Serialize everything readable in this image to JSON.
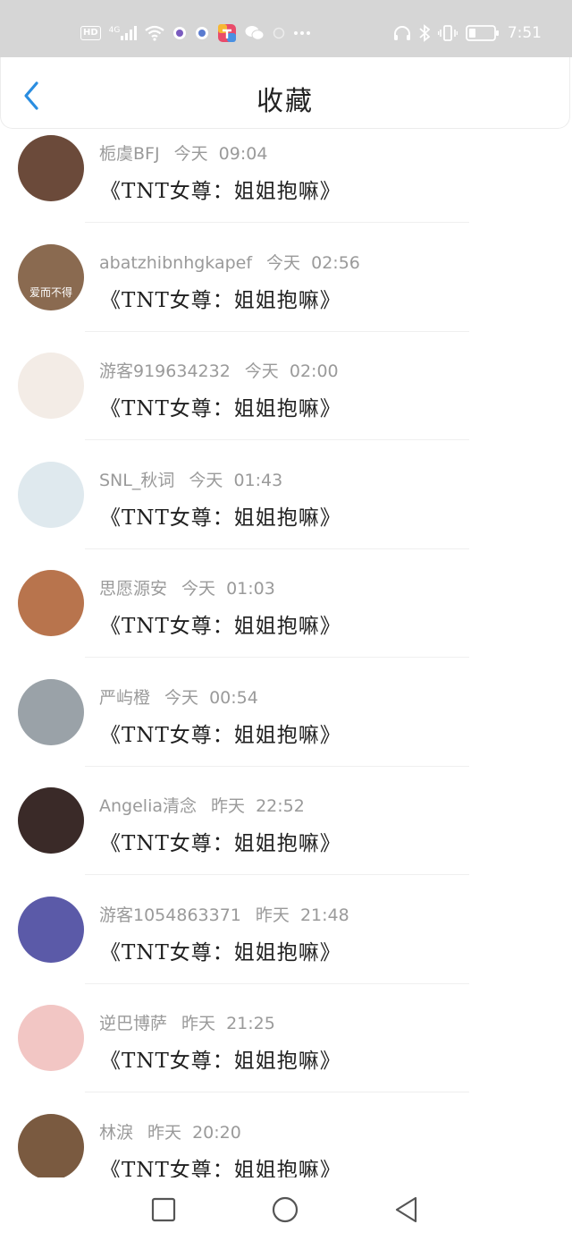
{
  "status_bar": {
    "hd": "HD",
    "network": "4G",
    "time": "7:51",
    "icons": [
      "hd-badge-icon",
      "signal-icon",
      "wifi-icon",
      "app-icon",
      "app-icon",
      "app-icon",
      "wechat-icon",
      "app-icon",
      "more-icon",
      "headphones-icon",
      "bluetooth-icon",
      "vibrate-icon",
      "battery-icon"
    ]
  },
  "header": {
    "title": "收藏"
  },
  "items": [
    {
      "user": "栀虞BFJ",
      "time": "今天  09:04",
      "message": "《TNT女尊：姐姐抱嘛》",
      "avatar_color": "#6b4a3a"
    },
    {
      "user": "abatzhibnhgkapef",
      "time": "今天  02:56",
      "message": "《TNT女尊：姐姐抱嘛》",
      "avatar_color": "#8a6a50",
      "avatar_text": "爱而不得"
    },
    {
      "user": "游客919634232",
      "time": "今天  02:00",
      "message": "《TNT女尊：姐姐抱嘛》",
      "avatar_color": "#f3ece6"
    },
    {
      "user": "SNL_秋词",
      "time": "今天  01:43",
      "message": "《TNT女尊：姐姐抱嘛》",
      "avatar_color": "#dfe9ee"
    },
    {
      "user": "思愿源安",
      "time": "今天  01:03",
      "message": "《TNT女尊：姐姐抱嘛》",
      "avatar_color": "#b8744d"
    },
    {
      "user": "严屿橙",
      "time": "今天  00:54",
      "message": "《TNT女尊：姐姐抱嘛》",
      "avatar_color": "#9aa2a8"
    },
    {
      "user": "Angelia清念",
      "time": "昨天  22:52",
      "message": "《TNT女尊：姐姐抱嘛》",
      "avatar_color": "#3a2a28"
    },
    {
      "user": "游客1054863371",
      "time": "昨天  21:48",
      "message": "《TNT女尊：姐姐抱嘛》",
      "avatar_color": "#5b5aa8"
    },
    {
      "user": "逆巴博萨",
      "time": "昨天  21:25",
      "message": "《TNT女尊：姐姐抱嘛》",
      "avatar_color": "#f2c6c4"
    },
    {
      "user": "林淚",
      "time": "昨天  20:20",
      "message": "《TNT女尊：姐姐抱嘛》",
      "avatar_color": "#7a5a40"
    }
  ],
  "navbar": {
    "buttons": [
      "recent-apps-icon",
      "home-icon",
      "back-icon"
    ]
  }
}
